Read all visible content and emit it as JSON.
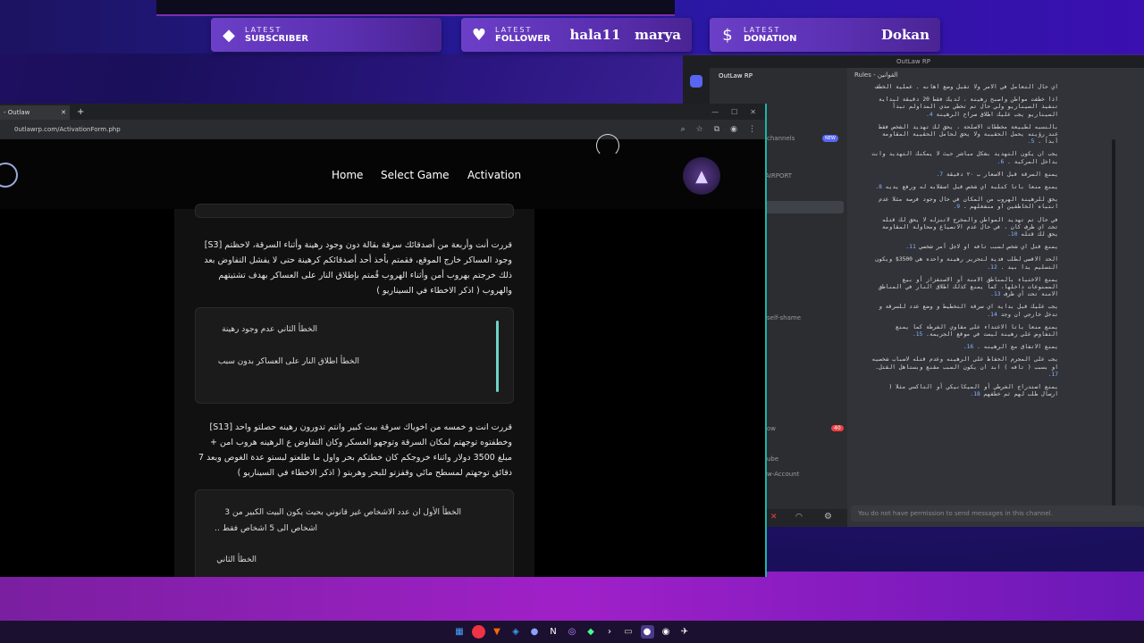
{
  "overlay": {
    "subscriber": {
      "line1": "LATEST",
      "line2": "SUBSCRIBER",
      "value": ""
    },
    "follower": {
      "line1": "LATEST",
      "line2": "FOLLOWER",
      "value": "hala11   marya"
    },
    "donation": {
      "line1": "LATEST",
      "line2": "DONATION",
      "value": "Dokan"
    }
  },
  "browser": {
    "tab_title": "- Outlaw",
    "url": "0utlawrp.com/ActivationForm.php",
    "nav": {
      "home": "Home",
      "select_game": "Select Game",
      "activation": "Activation"
    },
    "q1": "قررت أنت وأربعة من أصدقائك سرقة بقالة دون وجود رهينة وأثناء السرقة، لاحظتم [S3] وجود العساكر خارج الموقع، فقمتم بأخذ أحد أصدقائكم كرهينة حتى لا يفشل التفاوض بعد ذلك خرجتم بهروب أمن وأثناء الهروب قُمتم بإطلاق النار على العساكر بهدف تشتيتهم والهروب ( اذكر الاخطاء في السيناريو )",
    "a1_line1": "الخطأ الثاني عدم وجود رهينة",
    "a1_line2": "الخطأ اطلاق النار على العساكر بدون سبب",
    "q2": "قررت انت و خمسه من اخوياك سرقة بيت كبير وانتم تدورون رهينه حصلتو واحد [S13] وخطفتوه توجهتم لمكان السرقة وتوجهو العسكر وكان التفاوض ع الرهينه هروب امن + مبلغ 3500 دولار واثناء خروجكم كان خطتكم بحر واول ما طلعتو لبستو عدة الغوص وبعد 7 دقائق توجهتم لمسطح مائي وقفزتو للبحر وهربتو ( اذكر الاخطاء في السيناريو )",
    "a2_line1": "الخطأ الأول ان عدد الاشخاص غير قانوني بحيث يكون البيت الكبير من 3",
    "a2_line2": "اشخاص الى 5 اشخاص فقط ..",
    "a2_line3": "الخطأ الثاني"
  },
  "discord": {
    "window_title": "OutLaw RP",
    "server_name": "OutLaw RP",
    "tab": "Rules - القوانين",
    "badge_new": "NEW",
    "channels": [
      "channels",
      "AIRPORT",
      "self-shame",
      "ow",
      "ube",
      "w-Account"
    ],
    "no_permission": "You do not have permission to send messages in this channel.",
    "rules": [
      {
        "n": "",
        "t": "اي حال التعامل في الامر ولا تقبل وضع اهانه . عملية الخطف"
      },
      {
        "n": "4.",
        "t": "اذا خطفت مواطن واصبح رهينة ، لديك فقط 20 دقيقة لبداية تنفيذ السيناريو ولي حال تم تخطي مدي المداولم تبدأ السيناريو يجب عليك اطلاق سراح الرهينة"
      },
      {
        "n": "5.",
        "t": "بالنسبه لطبيعة مخططات الاسلحة ، يحق لك تهديد الشخص فقط عند رؤيته يحمل الحقيبة ولا يحق لحامل الحقيبة المقاومة أبداً ."
      },
      {
        "n": "6.",
        "t": "يجب ان يكون التهديد بشكل مباشر حيث لا يمكنك التهديد وانت بداخل المركبة ."
      },
      {
        "n": "7.",
        "t": "يمنع السرقة قبل الاسعار ب ٢٠ دقيقة"
      },
      {
        "n": "8.",
        "t": "يمنع منعا باتا كتلبة اي شخص قبل اسقلابه له ورفع يديه"
      },
      {
        "n": "9.",
        "t": "يحق للرهينة الهروب من المكان في حال وجود فرصة مثلا عدم انتباه الخاطفين او منشغلهم ."
      },
      {
        "n": "10.",
        "t": "في حال تم تهديد المواطن والمخرج لاتنزله لا يحق لك قتله تحت اي ظرف كان ، في حال عدم الانصياع ومحاولة المقاومة يحق لك قتله"
      },
      {
        "n": "11.",
        "t": "يمنع قتل اي شخص لسبب تافه او لاجل أمر شخصي"
      },
      {
        "n": "12.",
        "t": "الحد الاقصى لطلب فدية لتحرير رهينة واحده هي 3500$ ويكون التسليم يدا بيد ."
      },
      {
        "n": "13.",
        "t": "يمنع الاختباء بالمناطق الامنة أو الاستفزاز أو بيع الممنوعات داخلها، كما يمنع كذلك اطلاق النار في المناطق الامنة تحت أي ظرف"
      },
      {
        "n": "14.",
        "t": "يجب عليك قبل بداية اي سرقة التخطيط و وضع عدد للسرقة و تدخل خارجي ان وجد"
      },
      {
        "n": "15.",
        "t": "يمنع منعا باتا الاعتداء على مقاوي الشرطة كما يمنع التفاوض على رهينة ليست في موقع الجريمة."
      },
      {
        "n": "16.",
        "t": "يمنع الاتفاق مع الرهينه ."
      },
      {
        "n": "17.",
        "t": "يجب على المجرم الحفاظ على الرهينه وعدم قتله لاسباب شخصيه او بسبب ( تافه ) ابد ان يكون السبب مقنع وبستاهل القتل."
      },
      {
        "n": "18.",
        "t": "يمنع استدراج الشرطي أو الميكانيكي أو التاكسي مثلا ( ارسال طلب لهم ثم خطفهم"
      }
    ]
  },
  "colors": {
    "accent": "#1fb3a5",
    "overlay": "#6b3fc7",
    "discord_bg": "#313338"
  }
}
